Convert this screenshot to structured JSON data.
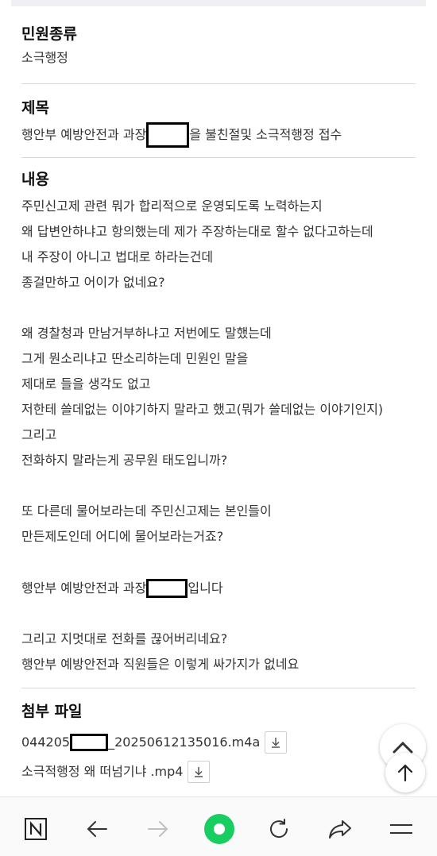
{
  "petition_type": {
    "heading": "민원종류",
    "value": "소극행정"
  },
  "subject": {
    "heading": "제목",
    "before": "행안부 예방안전과 과장",
    "after": "을 불친절및 소극적행정 접수"
  },
  "content": {
    "heading": "내용",
    "lines": [
      "주민신고제 관련 뭐가 합리적으로 운영되도록 노력하는지",
      "왜 답변안하냐고 항의했는데 제가 주장하는대로 할수 없다고하는데",
      "내 주장이 아니고 법대로 하라는건데",
      "종걸만하고 어이가 없네요?",
      "왜 경찰청과 만남거부하냐고 저번에도 말했는데",
      "그게 뭔소리냐고 딴소리하는데 민원인 말을",
      "제대로 들을 생각도 없고",
      "저한테 쓸데없는 이야기하지 말라고 했고(뭐가 쓸데없는 이야기인지)",
      "그리고",
      "전화하지 말라는게  공무원 태도입니까?",
      "또 다른데 물어보라는데 주민신고제는 본인들이",
      "만든제도인데 어디에 물어보라는거죠?",
      "행안부 예방안전과 과장",
      "입니다",
      "그리고 지멋대로 전화를 끊어버리네요?",
      "행안부 예방안전과 직원들은  이렇게 싸가지가 없네요"
    ]
  },
  "attachments": {
    "heading": "첨부 파일",
    "files": [
      {
        "prefix": "044205",
        "suffix": "_20250612135016.m4a"
      },
      {
        "prefix": "소극적행정 왜 떠넘기냐 .mp4",
        "suffix": ""
      }
    ]
  },
  "icons": {
    "chevron": "chevron-up-icon",
    "scroll_top": "arrow-up-icon",
    "download": "download-icon",
    "nav": [
      "naver-n-icon",
      "back-arrow-icon",
      "forward-arrow-icon",
      "home-dot-icon",
      "refresh-icon",
      "share-icon",
      "menu-icon"
    ]
  },
  "colors": {
    "accent_green": "#19ce60",
    "divider": "#d8d8d8",
    "disabled": "#c0c0c0"
  }
}
